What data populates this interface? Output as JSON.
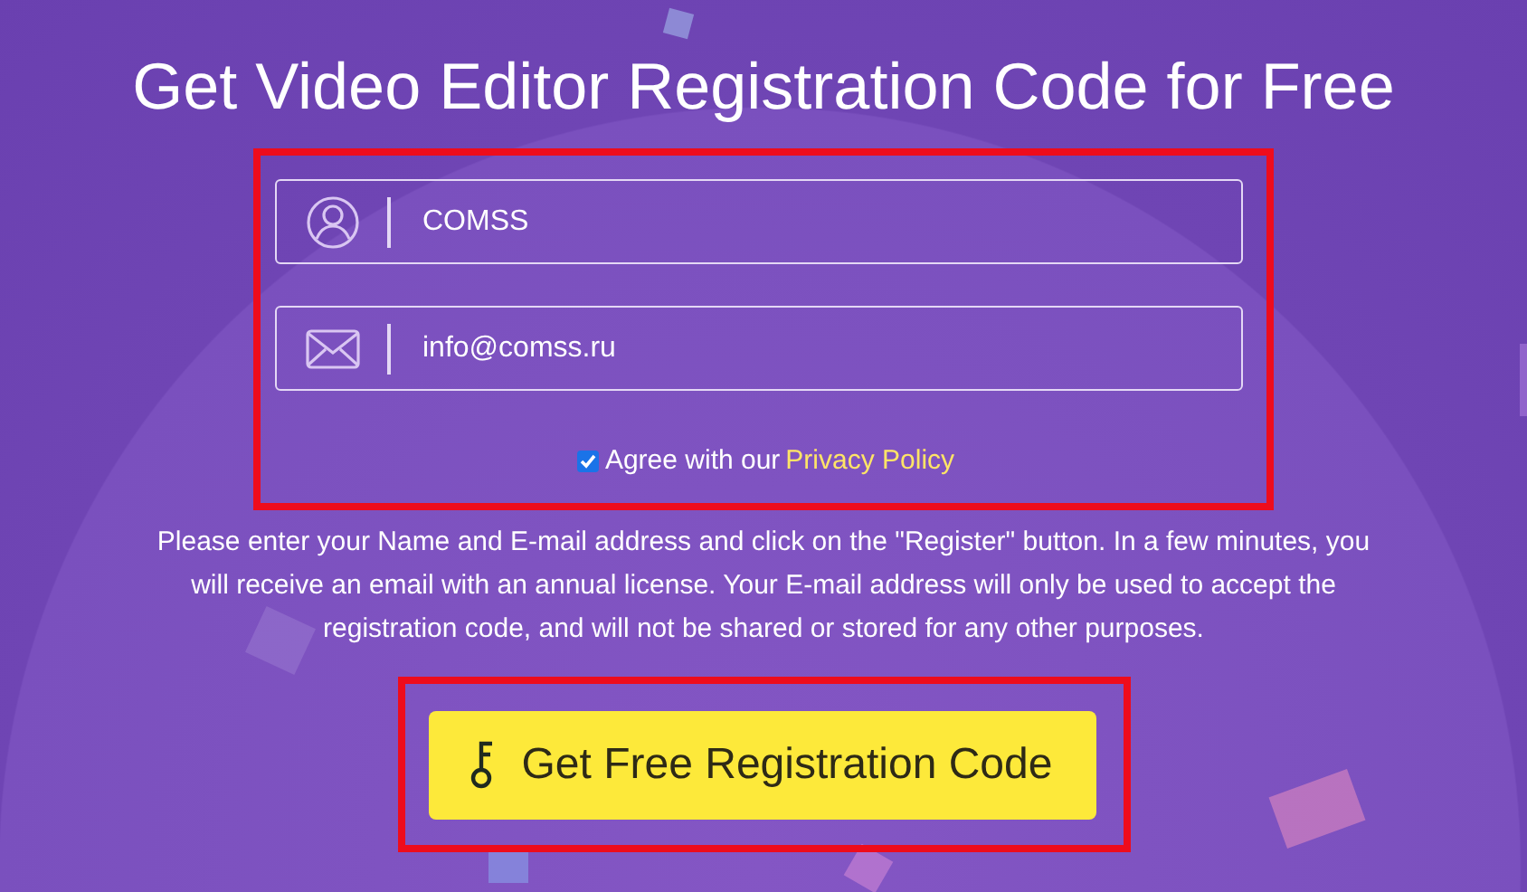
{
  "title": "Get Video Editor Registration Code for Free",
  "fields": [
    {
      "kind": "user",
      "value": "COMSS"
    },
    {
      "kind": "email",
      "value": "info@comss.ru"
    }
  ],
  "agreement": {
    "checked": true,
    "text": "Agree with our",
    "link": "Privacy Policy"
  },
  "note": "Please enter your Name and E-mail address and click on the \"Register\" button. In a few minutes, you will receive an email with an annual license. Your E-mail address will only be used to accept the registration code, and will not be shared or stored for any other purposes.",
  "button": {
    "label": "Get Free Registration Code"
  },
  "highlights": {
    "form": true,
    "button": true
  }
}
